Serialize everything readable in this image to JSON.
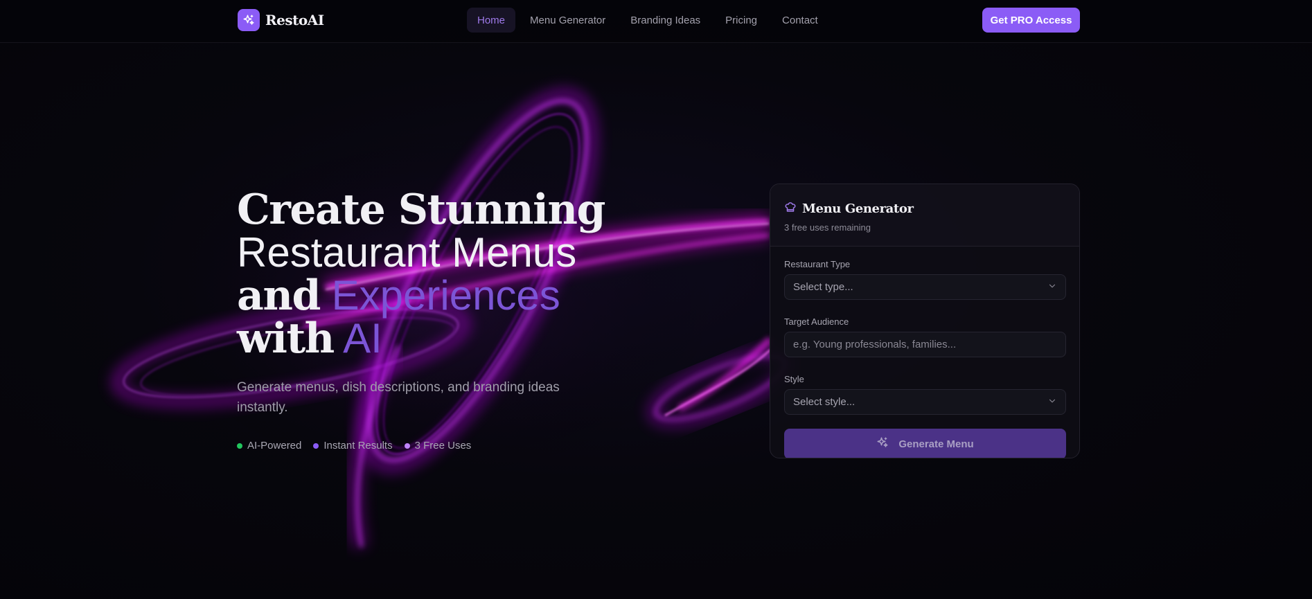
{
  "header": {
    "logo_text": "RestoAI",
    "nav": [
      {
        "label": "Home",
        "active": true
      },
      {
        "label": "Menu Generator",
        "active": false
      },
      {
        "label": "Branding Ideas",
        "active": false
      },
      {
        "label": "Pricing",
        "active": false
      },
      {
        "label": "Contact",
        "active": false
      }
    ],
    "cta_label": "Get PRO Access"
  },
  "hero": {
    "title_line1": "Create Stunning",
    "title_line2": "Restaurant Menus",
    "title_line3_a": "and",
    "title_line3_b": "Experiences",
    "title_line4_a": "with",
    "title_line4_b": "AI",
    "subtitle": "Generate menus, dish descriptions, and branding ideas instantly.",
    "features": [
      {
        "label": "AI-Powered",
        "color": "#22c55e"
      },
      {
        "label": "Instant Results",
        "color": "#8b5cf6"
      },
      {
        "label": "3 Free Uses",
        "color": "#c084fc"
      }
    ]
  },
  "generator": {
    "title": "Menu Generator",
    "subtitle": "3 free uses remaining",
    "restaurant_type": {
      "label": "Restaurant Type",
      "value": "Select type..."
    },
    "target_audience": {
      "label": "Target Audience",
      "placeholder": "e.g. Young professionals, families..."
    },
    "style": {
      "label": "Style",
      "value": "Select style..."
    },
    "button_label": "Generate Menu"
  },
  "icons": {
    "logo": "sparkles-icon",
    "card": "chef-hat-icon",
    "select": "chevron-down-icon",
    "button": "sparkles-icon"
  },
  "colors": {
    "accent": "#8b5cf6",
    "accent_text": "#7c55d6",
    "glow": "#ff00ff",
    "background": "#050509"
  }
}
